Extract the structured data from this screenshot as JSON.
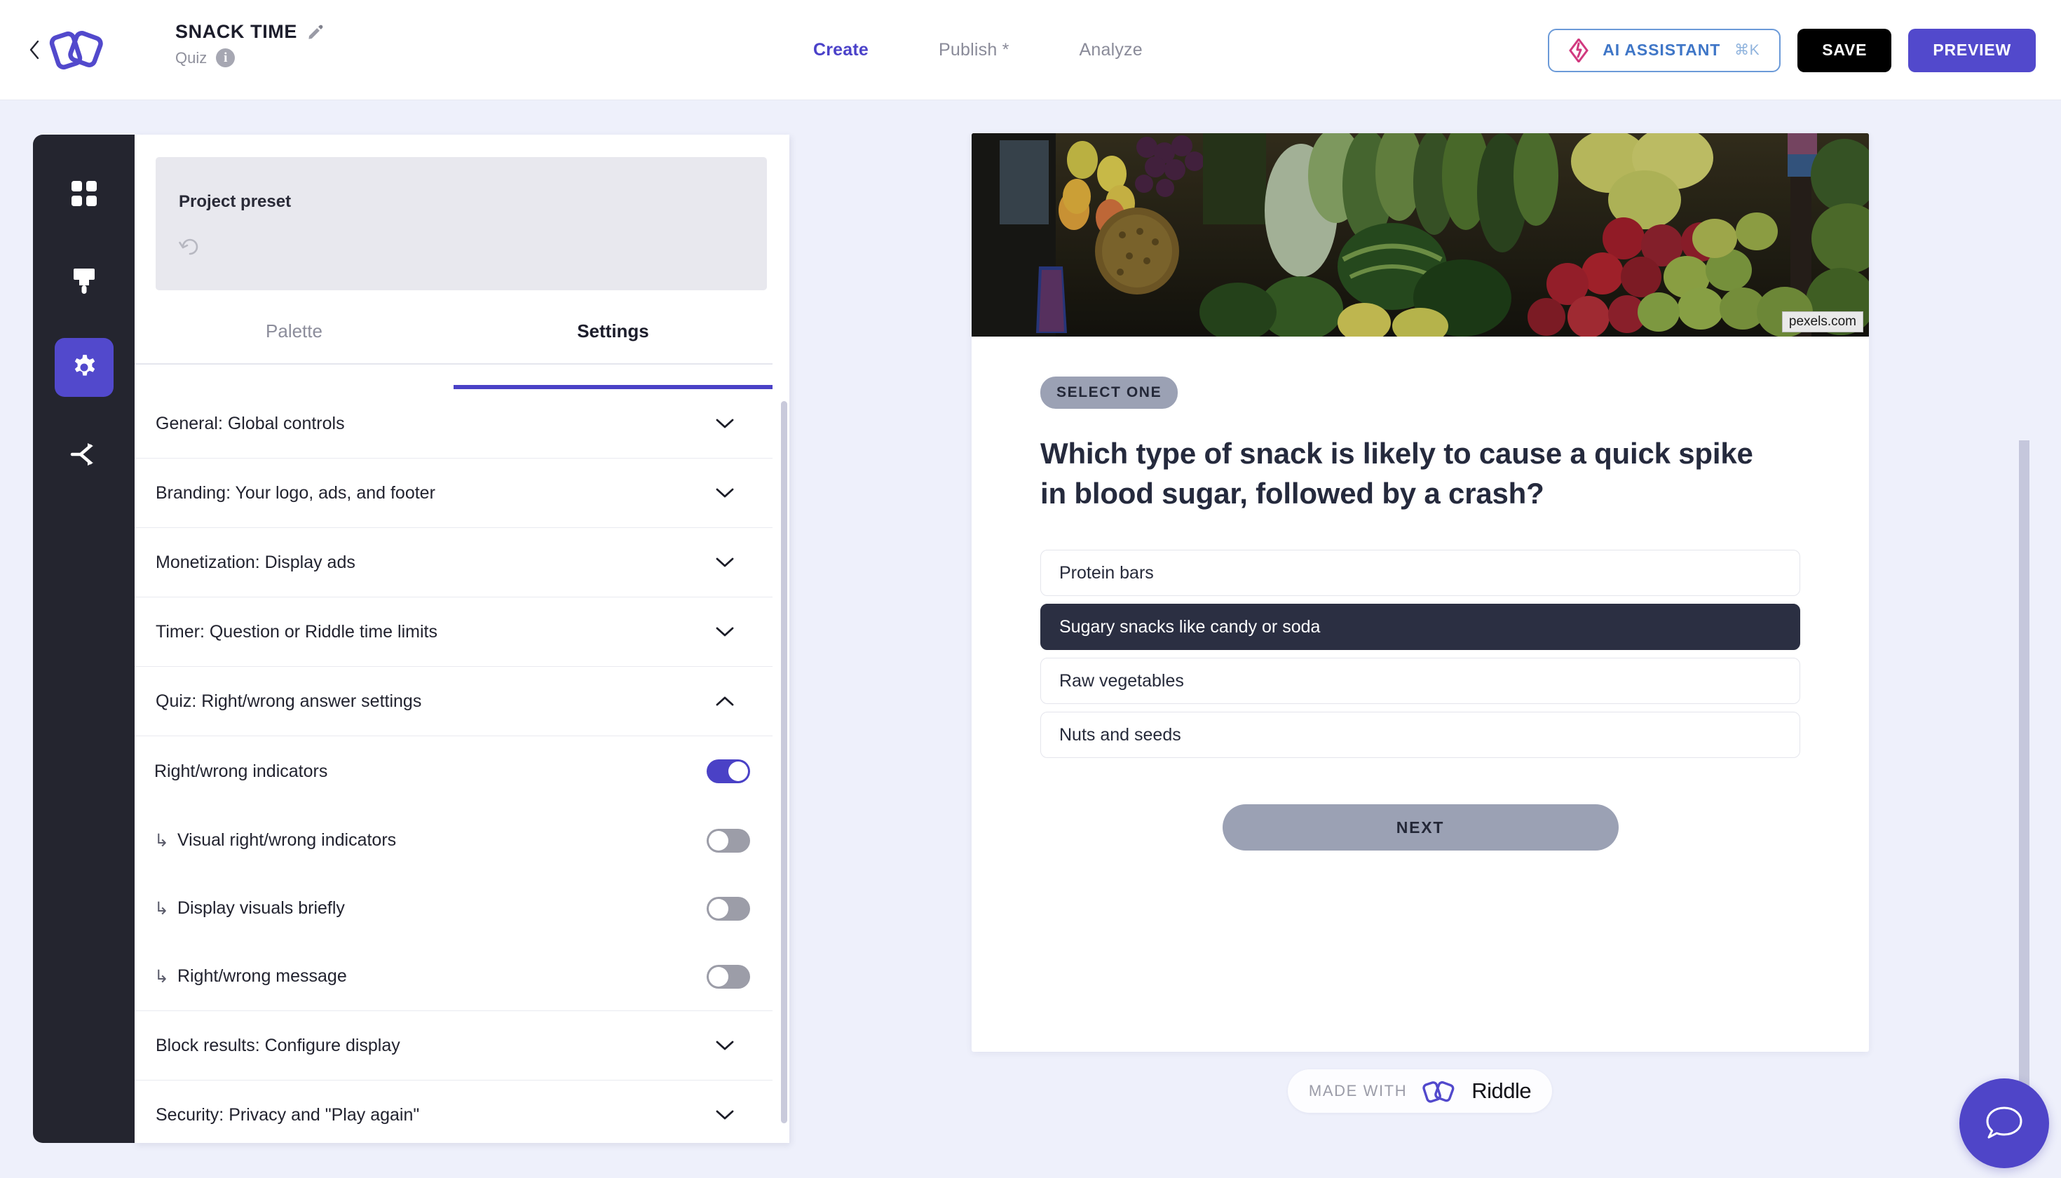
{
  "header": {
    "back_icon": "chevron-left-icon",
    "logo": "riddle-logo",
    "project_title": "SNACK TIME",
    "edit_icon": "pencil-icon",
    "project_type": "Quiz",
    "info_icon": "info-icon",
    "nav": [
      {
        "label": "Create",
        "active": true
      },
      {
        "label": "Publish *",
        "active": false
      },
      {
        "label": "Analyze",
        "active": false
      }
    ],
    "ai_assistant": {
      "label": "AI ASSISTANT",
      "shortcut": "⌘K",
      "icon": "ai-diamond-icon"
    },
    "save_label": "SAVE",
    "preview_label": "PREVIEW"
  },
  "rail": {
    "items": [
      {
        "name": "blocks",
        "icon": "grid-icon",
        "active": false
      },
      {
        "name": "design",
        "icon": "paintbrush-icon",
        "active": false
      },
      {
        "name": "settings",
        "icon": "gear-icon",
        "active": true
      },
      {
        "name": "share",
        "icon": "share-icon",
        "active": false
      }
    ]
  },
  "panel": {
    "preset_label": "Project preset",
    "undo_icon": "undo-icon",
    "tabs": [
      {
        "label": "Palette",
        "active": false
      },
      {
        "label": "Settings",
        "active": true
      }
    ],
    "accordions": [
      {
        "label": "General: Global controls",
        "expanded": false,
        "icon": "chevron-down-icon"
      },
      {
        "label": "Branding: Your logo, ads, and footer",
        "expanded": false,
        "icon": "chevron-down-icon"
      },
      {
        "label": "Monetization: Display ads",
        "expanded": false,
        "icon": "chevron-down-icon"
      },
      {
        "label": "Timer: Question or Riddle time limits",
        "expanded": false,
        "icon": "chevron-down-icon"
      },
      {
        "label": "Quiz: Right/wrong answer settings",
        "expanded": true,
        "icon": "chevron-up-icon"
      }
    ],
    "quiz_settings": [
      {
        "label": "Right/wrong indicators",
        "nested": false,
        "on": true
      },
      {
        "label": "Visual right/wrong indicators",
        "nested": true,
        "on": false
      },
      {
        "label": "Display visuals briefly",
        "nested": true,
        "on": false
      },
      {
        "label": "Right/wrong message",
        "nested": true,
        "on": false
      }
    ],
    "accordions_bottom": [
      {
        "label": "Block results: Configure display",
        "expanded": false,
        "icon": "chevron-down-icon"
      },
      {
        "label": "Security: Privacy and \"Play again\"",
        "expanded": false,
        "icon": "chevron-down-icon"
      }
    ],
    "nested_arrow": "↳"
  },
  "preview": {
    "hero_image_alt": "fruit-and-vegetable-market-stall",
    "hero_credit": "pexels.com",
    "badge": "SELECT ONE",
    "question": "Which type of snack is likely to cause a quick spike in blood sugar, followed by a crash?",
    "answers": [
      {
        "label": "Protein bars",
        "selected": false
      },
      {
        "label": "Sugary snacks like candy or soda",
        "selected": true
      },
      {
        "label": "Raw vegetables",
        "selected": false
      },
      {
        "label": "Nuts and seeds",
        "selected": false
      }
    ],
    "next_label": "NEXT",
    "made_with_text": "MADE WITH",
    "made_with_brand": "Riddle"
  },
  "chat": {
    "icon": "chat-bubble-icon"
  },
  "colors": {
    "accent": "#5249cc",
    "accent_dark": "#4a41c6",
    "dark_rail": "#24252f",
    "selected_answer": "#2b2f42",
    "muted_button": "#9ba1b4",
    "page_bg": "#eef0fb"
  }
}
